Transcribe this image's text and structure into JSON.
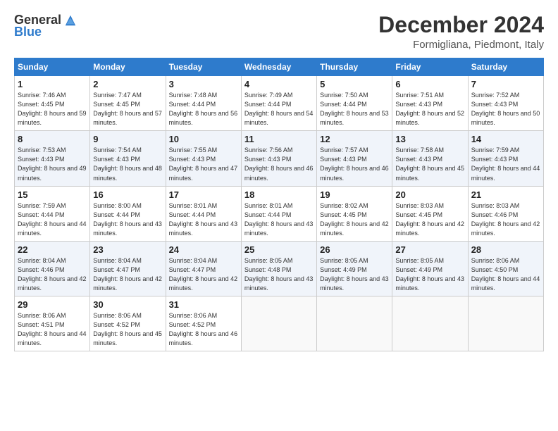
{
  "logo": {
    "general": "General",
    "blue": "Blue"
  },
  "header": {
    "month": "December 2024",
    "location": "Formigliana, Piedmont, Italy"
  },
  "days_of_week": [
    "Sunday",
    "Monday",
    "Tuesday",
    "Wednesday",
    "Thursday",
    "Friday",
    "Saturday"
  ],
  "weeks": [
    [
      {
        "day": "1",
        "sunrise": "Sunrise: 7:46 AM",
        "sunset": "Sunset: 4:45 PM",
        "daylight": "Daylight: 8 hours and 59 minutes."
      },
      {
        "day": "2",
        "sunrise": "Sunrise: 7:47 AM",
        "sunset": "Sunset: 4:45 PM",
        "daylight": "Daylight: 8 hours and 57 minutes."
      },
      {
        "day": "3",
        "sunrise": "Sunrise: 7:48 AM",
        "sunset": "Sunset: 4:44 PM",
        "daylight": "Daylight: 8 hours and 56 minutes."
      },
      {
        "day": "4",
        "sunrise": "Sunrise: 7:49 AM",
        "sunset": "Sunset: 4:44 PM",
        "daylight": "Daylight: 8 hours and 54 minutes."
      },
      {
        "day": "5",
        "sunrise": "Sunrise: 7:50 AM",
        "sunset": "Sunset: 4:44 PM",
        "daylight": "Daylight: 8 hours and 53 minutes."
      },
      {
        "day": "6",
        "sunrise": "Sunrise: 7:51 AM",
        "sunset": "Sunset: 4:43 PM",
        "daylight": "Daylight: 8 hours and 52 minutes."
      },
      {
        "day": "7",
        "sunrise": "Sunrise: 7:52 AM",
        "sunset": "Sunset: 4:43 PM",
        "daylight": "Daylight: 8 hours and 50 minutes."
      }
    ],
    [
      {
        "day": "8",
        "sunrise": "Sunrise: 7:53 AM",
        "sunset": "Sunset: 4:43 PM",
        "daylight": "Daylight: 8 hours and 49 minutes."
      },
      {
        "day": "9",
        "sunrise": "Sunrise: 7:54 AM",
        "sunset": "Sunset: 4:43 PM",
        "daylight": "Daylight: 8 hours and 48 minutes."
      },
      {
        "day": "10",
        "sunrise": "Sunrise: 7:55 AM",
        "sunset": "Sunset: 4:43 PM",
        "daylight": "Daylight: 8 hours and 47 minutes."
      },
      {
        "day": "11",
        "sunrise": "Sunrise: 7:56 AM",
        "sunset": "Sunset: 4:43 PM",
        "daylight": "Daylight: 8 hours and 46 minutes."
      },
      {
        "day": "12",
        "sunrise": "Sunrise: 7:57 AM",
        "sunset": "Sunset: 4:43 PM",
        "daylight": "Daylight: 8 hours and 46 minutes."
      },
      {
        "day": "13",
        "sunrise": "Sunrise: 7:58 AM",
        "sunset": "Sunset: 4:43 PM",
        "daylight": "Daylight: 8 hours and 45 minutes."
      },
      {
        "day": "14",
        "sunrise": "Sunrise: 7:59 AM",
        "sunset": "Sunset: 4:43 PM",
        "daylight": "Daylight: 8 hours and 44 minutes."
      }
    ],
    [
      {
        "day": "15",
        "sunrise": "Sunrise: 7:59 AM",
        "sunset": "Sunset: 4:44 PM",
        "daylight": "Daylight: 8 hours and 44 minutes."
      },
      {
        "day": "16",
        "sunrise": "Sunrise: 8:00 AM",
        "sunset": "Sunset: 4:44 PM",
        "daylight": "Daylight: 8 hours and 43 minutes."
      },
      {
        "day": "17",
        "sunrise": "Sunrise: 8:01 AM",
        "sunset": "Sunset: 4:44 PM",
        "daylight": "Daylight: 8 hours and 43 minutes."
      },
      {
        "day": "18",
        "sunrise": "Sunrise: 8:01 AM",
        "sunset": "Sunset: 4:44 PM",
        "daylight": "Daylight: 8 hours and 43 minutes."
      },
      {
        "day": "19",
        "sunrise": "Sunrise: 8:02 AM",
        "sunset": "Sunset: 4:45 PM",
        "daylight": "Daylight: 8 hours and 42 minutes."
      },
      {
        "day": "20",
        "sunrise": "Sunrise: 8:03 AM",
        "sunset": "Sunset: 4:45 PM",
        "daylight": "Daylight: 8 hours and 42 minutes."
      },
      {
        "day": "21",
        "sunrise": "Sunrise: 8:03 AM",
        "sunset": "Sunset: 4:46 PM",
        "daylight": "Daylight: 8 hours and 42 minutes."
      }
    ],
    [
      {
        "day": "22",
        "sunrise": "Sunrise: 8:04 AM",
        "sunset": "Sunset: 4:46 PM",
        "daylight": "Daylight: 8 hours and 42 minutes."
      },
      {
        "day": "23",
        "sunrise": "Sunrise: 8:04 AM",
        "sunset": "Sunset: 4:47 PM",
        "daylight": "Daylight: 8 hours and 42 minutes."
      },
      {
        "day": "24",
        "sunrise": "Sunrise: 8:04 AM",
        "sunset": "Sunset: 4:47 PM",
        "daylight": "Daylight: 8 hours and 42 minutes."
      },
      {
        "day": "25",
        "sunrise": "Sunrise: 8:05 AM",
        "sunset": "Sunset: 4:48 PM",
        "daylight": "Daylight: 8 hours and 43 minutes."
      },
      {
        "day": "26",
        "sunrise": "Sunrise: 8:05 AM",
        "sunset": "Sunset: 4:49 PM",
        "daylight": "Daylight: 8 hours and 43 minutes."
      },
      {
        "day": "27",
        "sunrise": "Sunrise: 8:05 AM",
        "sunset": "Sunset: 4:49 PM",
        "daylight": "Daylight: 8 hours and 43 minutes."
      },
      {
        "day": "28",
        "sunrise": "Sunrise: 8:06 AM",
        "sunset": "Sunset: 4:50 PM",
        "daylight": "Daylight: 8 hours and 44 minutes."
      }
    ],
    [
      {
        "day": "29",
        "sunrise": "Sunrise: 8:06 AM",
        "sunset": "Sunset: 4:51 PM",
        "daylight": "Daylight: 8 hours and 44 minutes."
      },
      {
        "day": "30",
        "sunrise": "Sunrise: 8:06 AM",
        "sunset": "Sunset: 4:52 PM",
        "daylight": "Daylight: 8 hours and 45 minutes."
      },
      {
        "day": "31",
        "sunrise": "Sunrise: 8:06 AM",
        "sunset": "Sunset: 4:52 PM",
        "daylight": "Daylight: 8 hours and 46 minutes."
      },
      null,
      null,
      null,
      null
    ]
  ]
}
